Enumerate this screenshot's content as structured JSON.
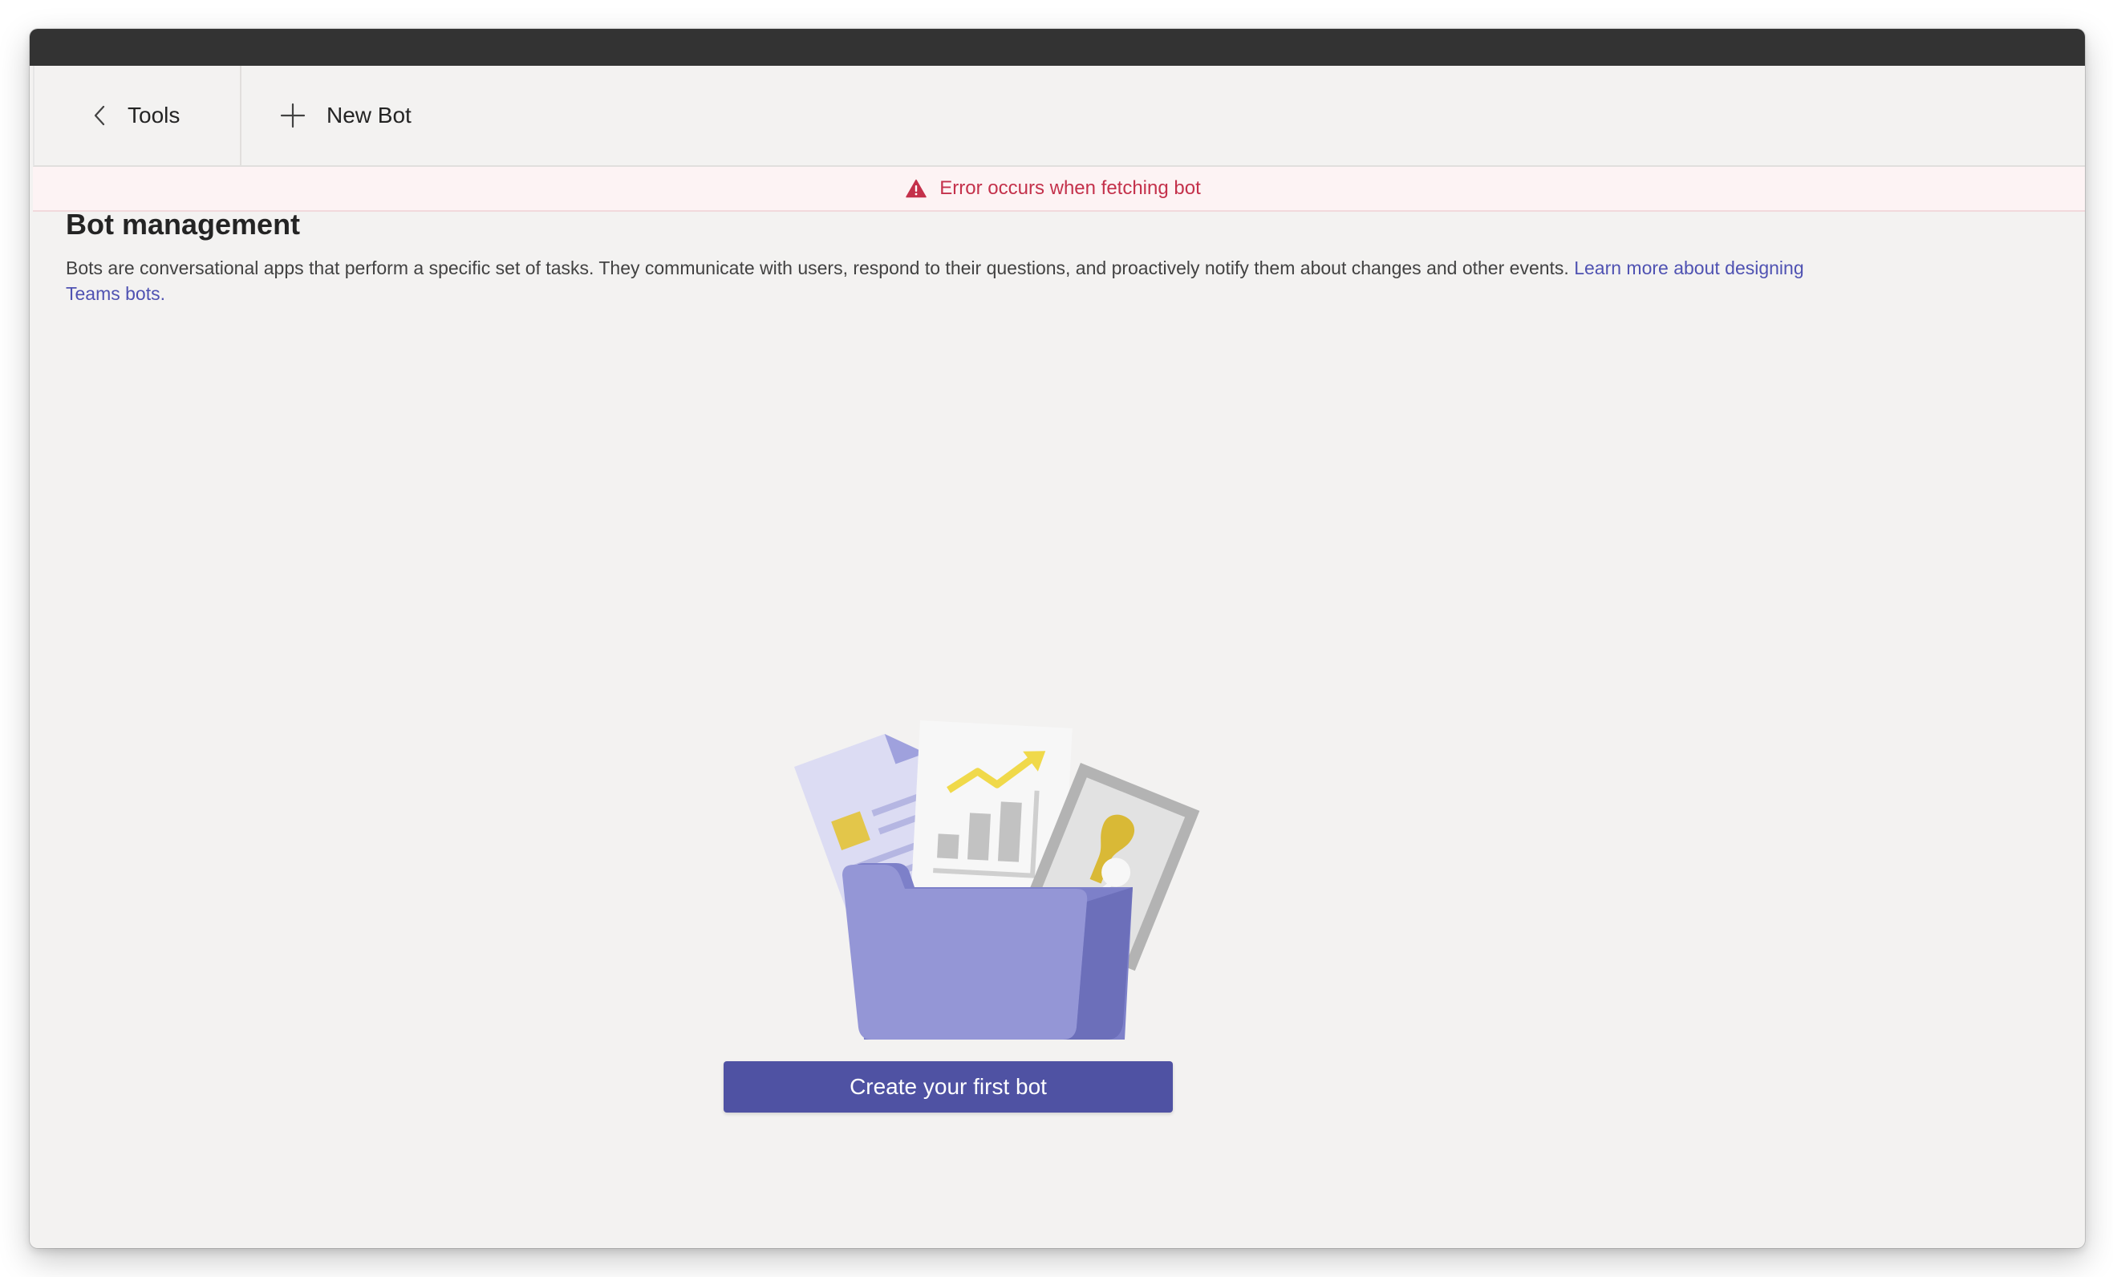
{
  "toolbar": {
    "back_label": "Tools",
    "new_label": "New Bot"
  },
  "banner": {
    "error_text": "Error occurs when fetching bot"
  },
  "main": {
    "title": "Bot management",
    "description": "Bots are conversational apps that perform a specific set of tasks. They communicate with users, respond to their questions, and proactively notify them about changes and other events. ",
    "learn_more_link": "Learn more about designing Teams bots."
  },
  "empty_state": {
    "cta_label": "Create your first bot"
  },
  "icons": {
    "back": "chevron-left-icon",
    "add": "plus-icon",
    "warning": "warning-triangle-icon"
  },
  "colors": {
    "accent": "#4f52a3",
    "link": "#4f52b2",
    "error": "#c4314b",
    "error_bg": "#fdf3f4",
    "titlebar": "#333333",
    "background": "#f3f2f1"
  }
}
